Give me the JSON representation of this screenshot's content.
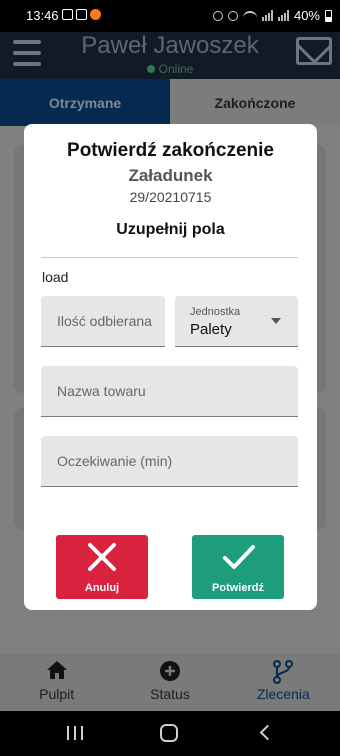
{
  "status_bar": {
    "time": "13:46",
    "battery": "40%"
  },
  "header": {
    "user_name": "Paweł Jawoszek",
    "status": "Online"
  },
  "tabs": [
    {
      "label": "Otrzymane",
      "active": true
    },
    {
      "label": "Zakończone",
      "active": false
    }
  ],
  "dialog": {
    "title": "Potwierdź zakończenie",
    "subtitle": "Załadunek",
    "order_number": "29/20210715",
    "section_title": "Uzupełnij pola",
    "load_label": "load",
    "quantity_placeholder": "Ilość odbierana",
    "unit_label": "Jednostka",
    "unit_value": "Palety",
    "goods_name_placeholder": "Nazwa towaru",
    "waiting_placeholder": "Oczekiwanie (min)",
    "cancel_label": "Anuluj",
    "confirm_label": "Potwierdź"
  },
  "bottom_nav": [
    {
      "label": "Pulpit",
      "icon": "home-icon",
      "active": false
    },
    {
      "label": "Status",
      "icon": "plus-circle-icon",
      "active": false
    },
    {
      "label": "Zlecenia",
      "icon": "branch-icon",
      "active": true
    }
  ],
  "colors": {
    "header_bg": "#111a26",
    "active_tab": "#062a4f",
    "cancel": "#d9223d",
    "confirm": "#1d9d7c",
    "online": "#2f7a50"
  }
}
